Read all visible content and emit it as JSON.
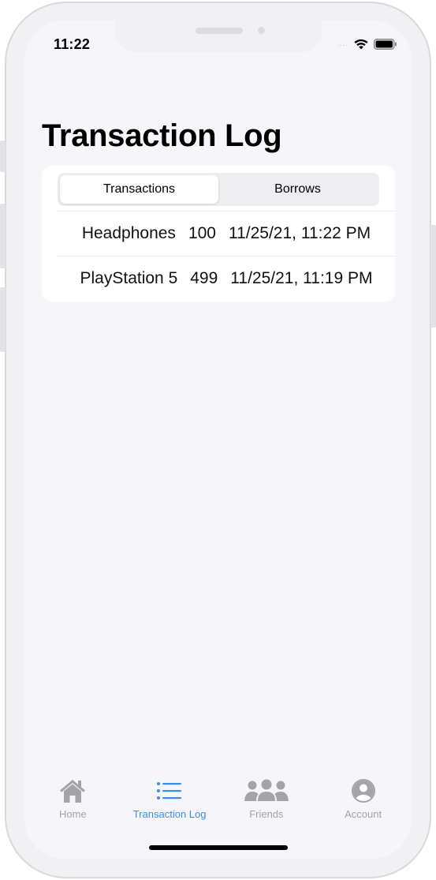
{
  "status_bar": {
    "time": "11:22",
    "signal_dots": "....",
    "wifi_icon": "wifi-icon",
    "battery_icon": "battery-icon"
  },
  "page": {
    "title": "Transaction Log"
  },
  "segmented_control": {
    "segments": [
      {
        "label": "Transactions",
        "selected": true
      },
      {
        "label": "Borrows",
        "selected": false
      }
    ]
  },
  "transactions": [
    {
      "item": "Headphones",
      "amount": "100",
      "datetime": "11/25/21, 11:22 PM"
    },
    {
      "item": "PlayStation 5",
      "amount": "499",
      "datetime": "11/25/21, 11:19 PM"
    }
  ],
  "tab_bar": {
    "items": [
      {
        "label": "Home",
        "icon": "house-icon",
        "active": false
      },
      {
        "label": "Transaction Log",
        "icon": "list-icon",
        "active": true
      },
      {
        "label": "Friends",
        "icon": "people-icon",
        "active": false
      },
      {
        "label": "Account",
        "icon": "person-circle-icon",
        "active": false
      }
    ]
  },
  "colors": {
    "accent": "#3b8ee8",
    "inactive_tab": "#a3a3a8",
    "background": "#f6f6fa"
  }
}
